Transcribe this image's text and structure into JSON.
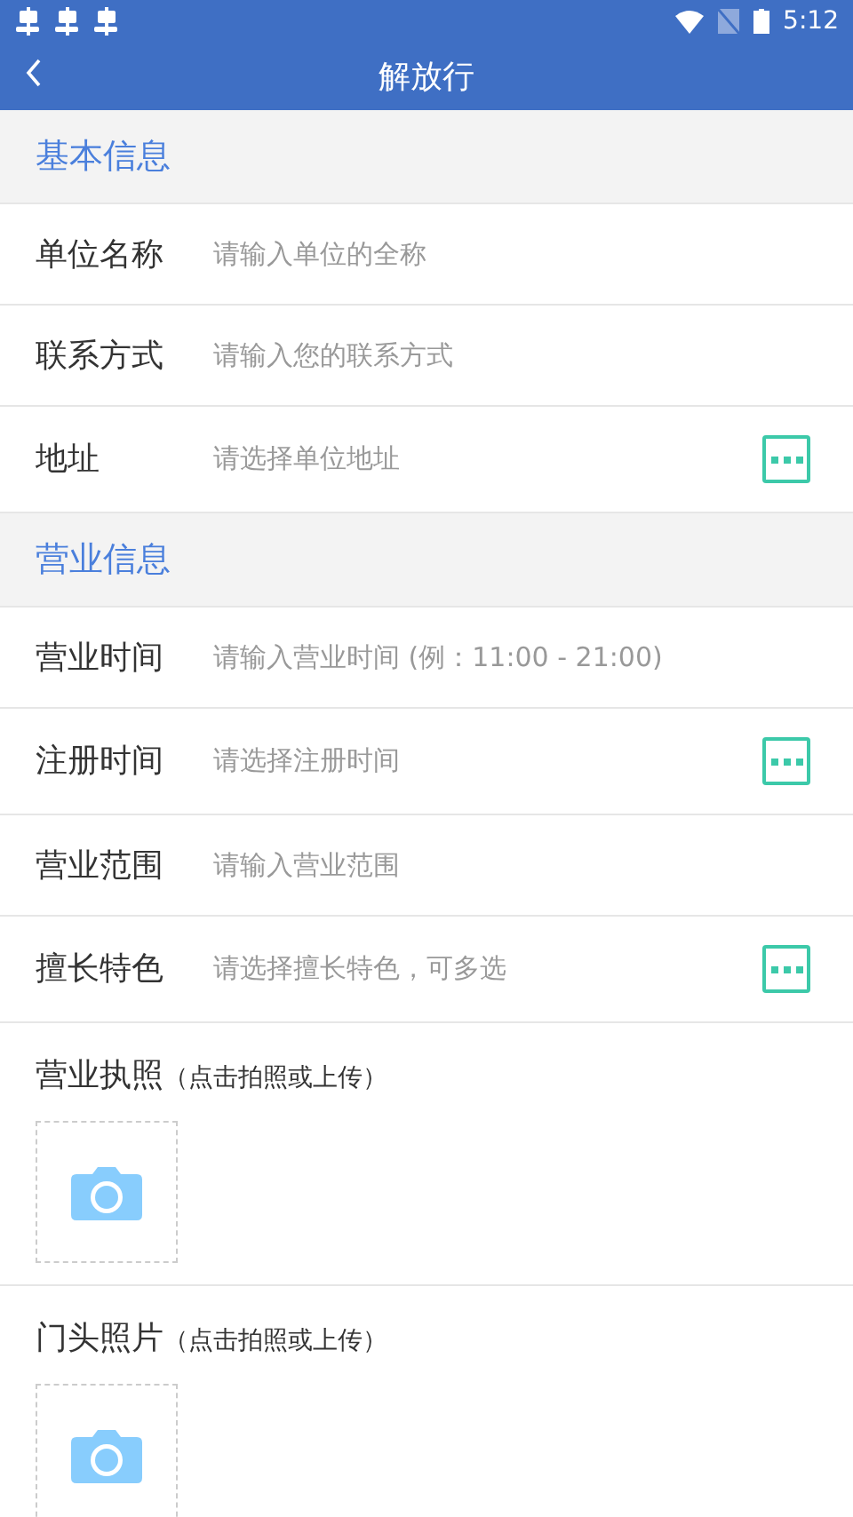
{
  "status_bar": {
    "time": "5:12"
  },
  "toolbar": {
    "title": "解放行"
  },
  "sections": [
    {
      "title": "基本信息",
      "fields": [
        {
          "kind": "input",
          "label": "单位名称",
          "placeholder": "请输入单位的全称"
        },
        {
          "kind": "input",
          "label": "联系方式",
          "placeholder": "请输入您的联系方式"
        },
        {
          "kind": "picker",
          "label": "地址",
          "placeholder": "请选择单位地址"
        }
      ]
    },
    {
      "title": "营业信息",
      "fields": [
        {
          "kind": "input",
          "label": "营业时间",
          "placeholder": "请输入营业时间 (例：11:00 - 21:00)"
        },
        {
          "kind": "picker",
          "label": "注册时间",
          "placeholder": "请选择注册时间"
        },
        {
          "kind": "input",
          "label": "营业范围",
          "placeholder": "请输入营业范围"
        },
        {
          "kind": "picker",
          "label": "擅长特色",
          "placeholder": "请选择擅长特色，可多选"
        }
      ]
    }
  ],
  "uploads": [
    {
      "label": "营业执照",
      "hint": "（点击拍照或上传）"
    },
    {
      "label": "门头照片",
      "hint": "（点击拍照或上传）"
    }
  ]
}
